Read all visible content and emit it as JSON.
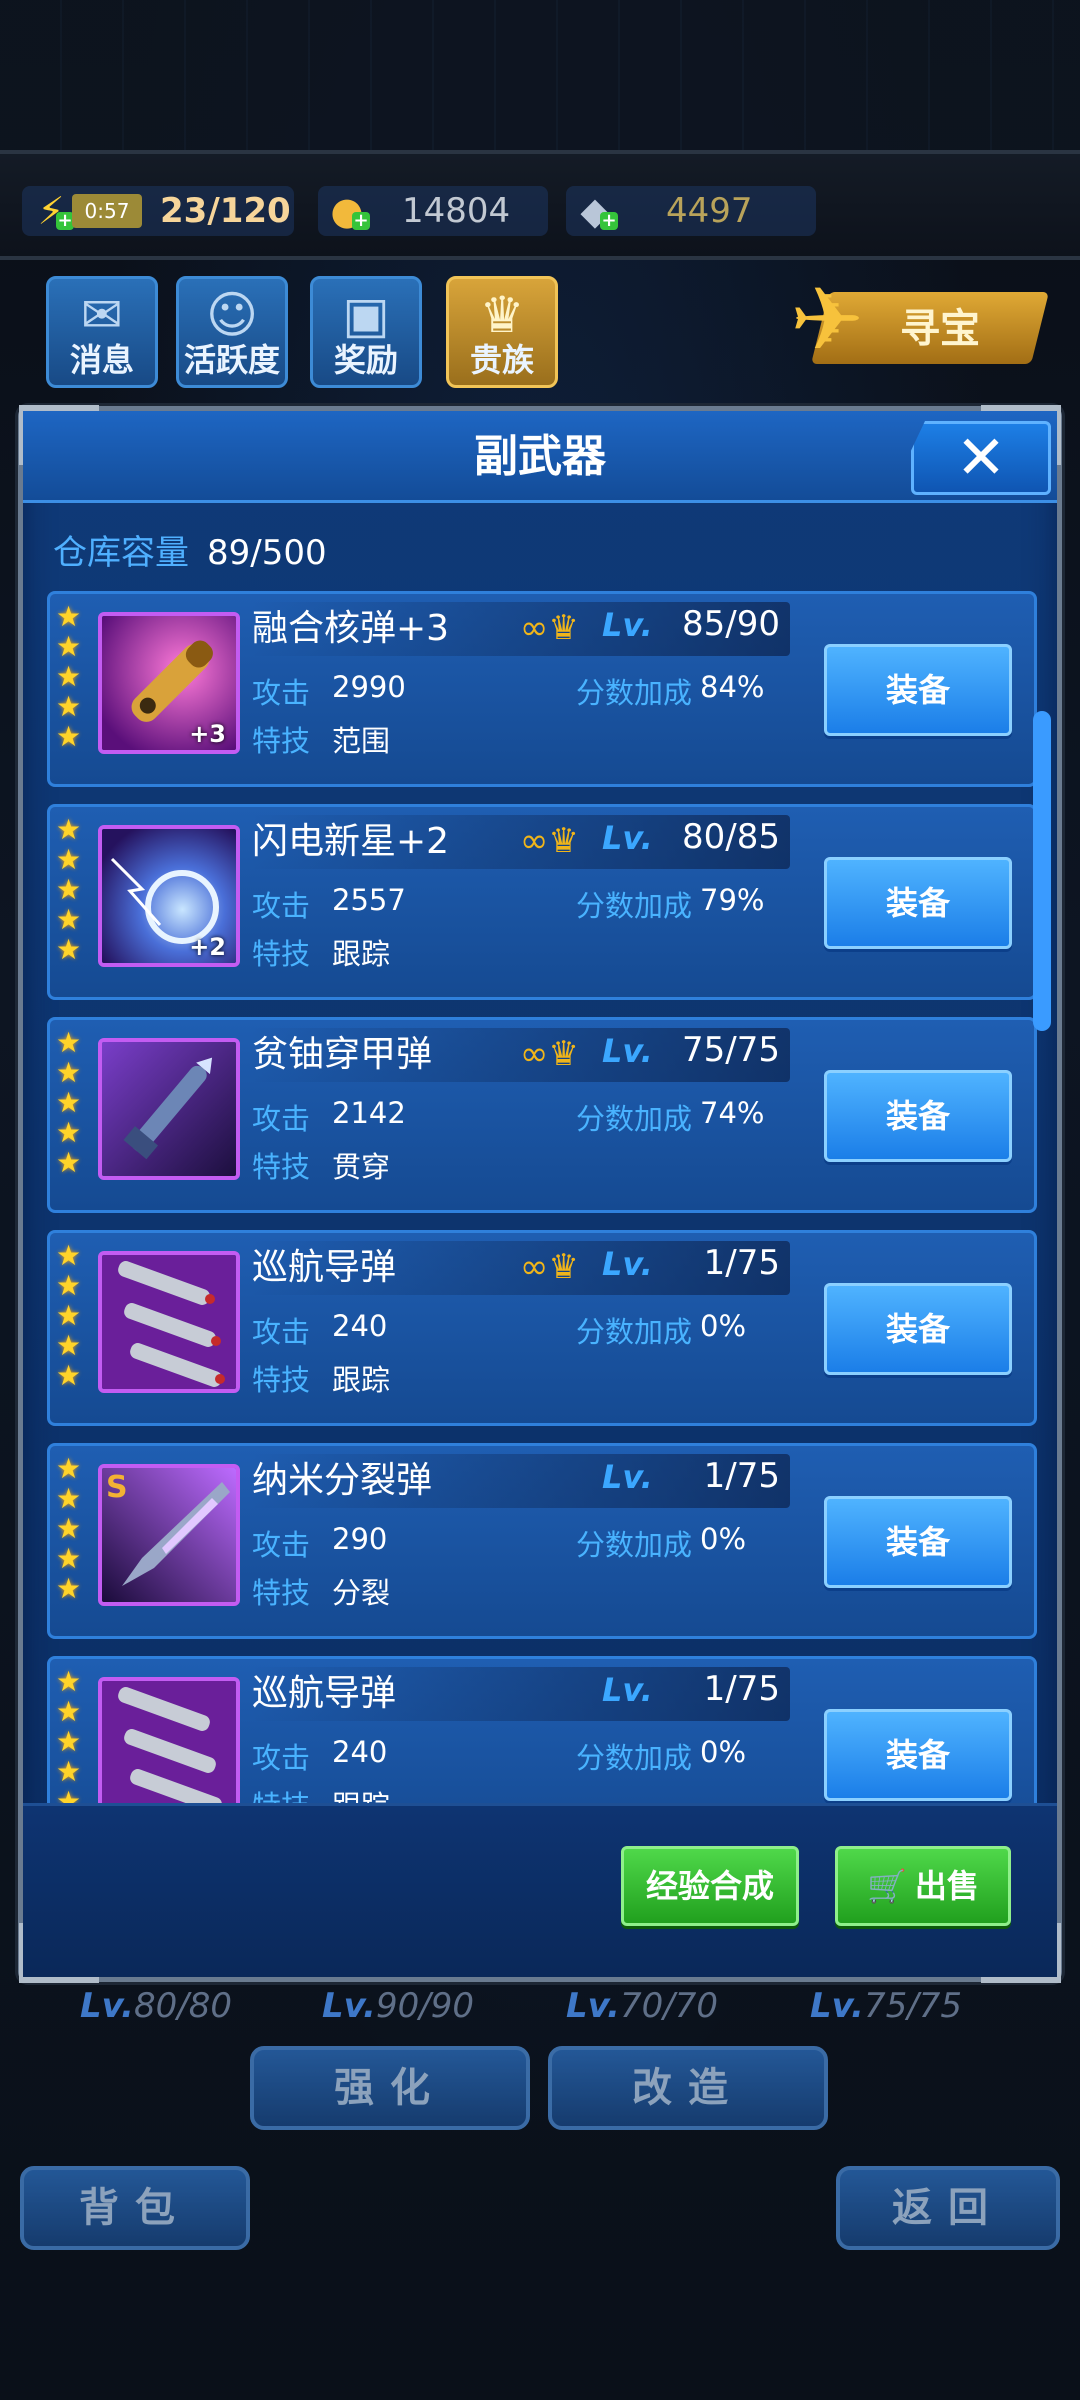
{
  "top_bar": {
    "energy": {
      "timer": "0:57",
      "value": "23/120",
      "icon": "lightning-icon"
    },
    "gold": {
      "value": "14804",
      "icon": "gold-coin-icon"
    },
    "gem": {
      "value": "4497",
      "icon": "diamond-icon"
    }
  },
  "shortcuts": [
    {
      "label": "消息",
      "icon": "message-icon"
    },
    {
      "label": "活跃度",
      "icon": "activity-icon"
    },
    {
      "label": "奖励",
      "icon": "gift-icon"
    },
    {
      "label": "贵族",
      "icon": "noble-badge-icon"
    }
  ],
  "treasure": {
    "label": "寻宝",
    "icon": "jet-fighter-icon"
  },
  "dialog": {
    "title": "副武器",
    "close": "✕",
    "capacity_label": "仓库容量",
    "capacity_value": "89/500",
    "stat_labels": {
      "attack": "攻击",
      "score_bonus": "分数加成",
      "skill": "特技",
      "lv": "Lv."
    },
    "items": [
      {
        "name": "融合核弹+3",
        "level": "85/90",
        "attack": "2990",
        "bonus": "84%",
        "skill": "范围",
        "stars": 5,
        "linked": true,
        "plus": "+3",
        "equip": "装备"
      },
      {
        "name": "闪电新星+2",
        "level": "80/85",
        "attack": "2557",
        "bonus": "79%",
        "skill": "跟踪",
        "stars": 5,
        "linked": true,
        "plus": "+2",
        "equip": "装备"
      },
      {
        "name": "贫铀穿甲弹",
        "level": "75/75",
        "attack": "2142",
        "bonus": "74%",
        "skill": "贯穿",
        "stars": 5,
        "linked": true,
        "plus": "",
        "equip": "装备"
      },
      {
        "name": "巡航导弹",
        "level": "1/75",
        "attack": "240",
        "bonus": "0%",
        "skill": "跟踪",
        "stars": 5,
        "linked": true,
        "plus": "",
        "equip": "装备"
      },
      {
        "name": "纳米分裂弹",
        "level": "1/75",
        "attack": "290",
        "bonus": "0%",
        "skill": "分裂",
        "stars": 5,
        "linked": false,
        "plus": "",
        "equip": "装备",
        "s_tag": "S"
      },
      {
        "name": "巡航导弹",
        "level": "1/75",
        "attack": "240",
        "bonus": "0%",
        "skill": "跟踪",
        "stars": 5,
        "linked": false,
        "plus": "",
        "equip": "装备"
      }
    ],
    "footer": {
      "synth": "经验合成",
      "sell": "出售"
    }
  },
  "background": {
    "levels": [
      {
        "lv": "Lv.",
        "val": "80/80"
      },
      {
        "lv": "Lv.",
        "val": "90/90"
      },
      {
        "lv": "Lv.",
        "val": "70/70"
      },
      {
        "lv": "Lv.",
        "val": "75/75"
      }
    ],
    "buttons": {
      "enhance": "强化",
      "modify": "改造",
      "backpack": "背包",
      "back": "返回"
    }
  },
  "colors": {
    "accent_blue": "#1b7ee8",
    "star": "#ffd42a",
    "green": "#21a01e",
    "purple_frame": "#c35cf2"
  }
}
